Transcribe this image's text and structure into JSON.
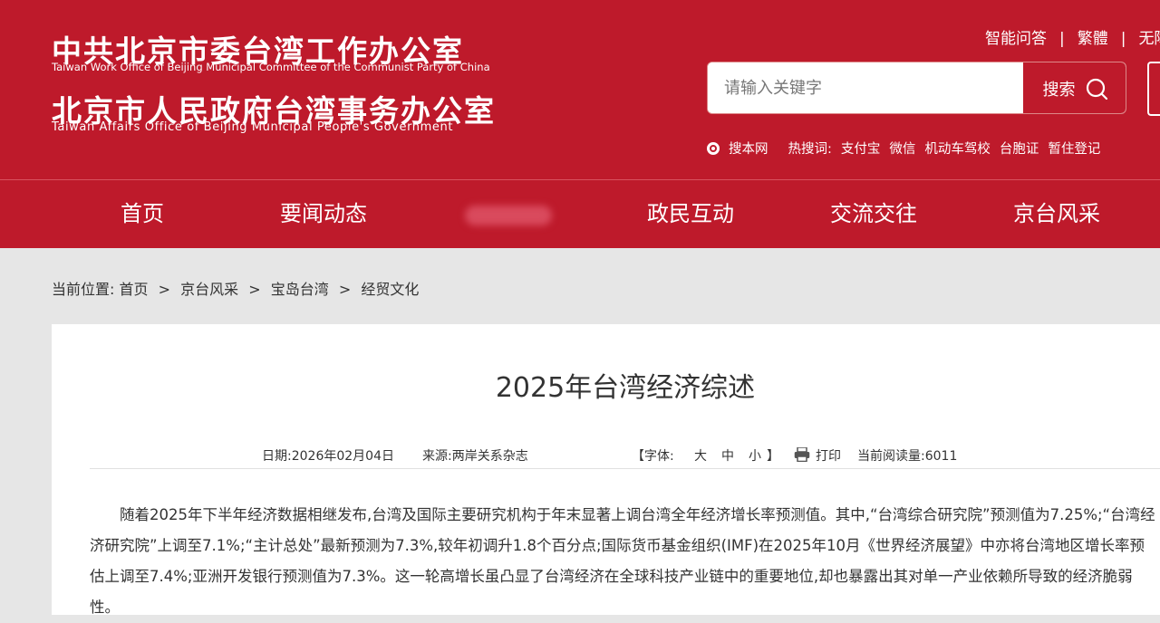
{
  "header": {
    "logo_cn_1": "中共北京市委台湾工作办公室",
    "logo_en_1": "Taiwan Work Office of Beijing Municipal Committee of the Communist Party of China",
    "logo_cn_2": "北京市人民政府台湾事务办公室",
    "logo_en_2": "Taiwan Affairs Office of Beijing Municipal People's Government",
    "top_links": [
      "智能问答",
      "繁體",
      "无障"
    ],
    "top_link_separator": "|",
    "search": {
      "placeholder": "请输入关键字",
      "button_label": "搜索"
    },
    "site_search_label": "搜本网",
    "hot_label": "热搜词:",
    "hot_words": [
      "支付宝",
      "微信",
      "机动车驾校",
      "台胞证",
      "暂住登记"
    ]
  },
  "nav": {
    "items": [
      "首页",
      "要闻动态",
      "政民互动",
      "交流交往",
      "京台风采"
    ]
  },
  "breadcrumb": {
    "prefix": "当前位置:",
    "items": [
      "首页",
      "京台风采",
      "宝岛台湾",
      "经贸文化"
    ],
    "separator": ">"
  },
  "article": {
    "title": "2025年台湾经济综述",
    "date": "日期:2026年02月04日",
    "source": "来源:两岸关系杂志",
    "font_label": "【字体:",
    "font_sizes": [
      "大",
      "中",
      "小"
    ],
    "font_close": "】",
    "print_label": "打印",
    "reads_label": "当前阅读量:",
    "reads_count": "6011",
    "paragraph": "随着2025年下半年经济数据相继发布,台湾及国际主要研究机构于年末显著上调台湾全年经济增长率预测值。其中,“台湾综合研究院”预测值为7.25%;“台湾经济研究院”上调至7.1%;“主计总处”最新预测为7.3%,较年初调升1.8个百分点;国际货币基金组织(IMF)在2025年10月《世界经济展望》中亦将台湾地区增长率预估上调至7.4%;亚洲开发银行预测值为7.3%。这一轮高增长虽凸显了台湾经济在全球科技产业链中的重要地位,却也暴露出其对单一产业依赖所导致的经济脆弱性。"
  },
  "colors": {
    "brand_red": "#be1a2b",
    "page_bg": "#e6e6e6"
  },
  "icons": [
    "search-icon",
    "print-icon",
    "radio-icon"
  ]
}
